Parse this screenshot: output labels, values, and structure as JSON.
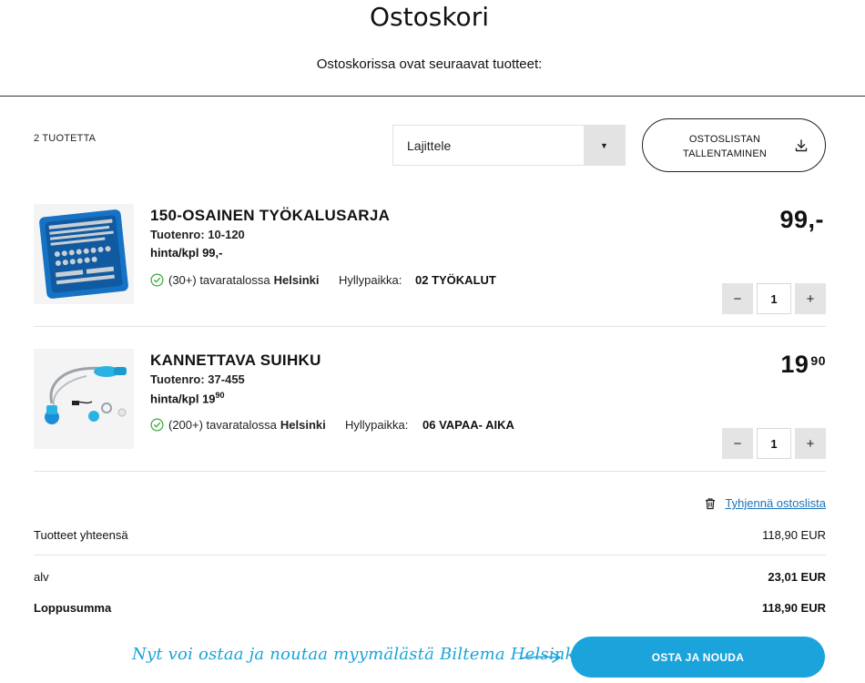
{
  "header": {
    "title": "Ostoskori",
    "subtitle": "Ostoskorissa ovat seuraavat tuotteet:"
  },
  "toolbar": {
    "product_count": "2 TUOTETTA",
    "sort_label": "Lajittele",
    "save_list_line1": "OSTOSLISTAN",
    "save_list_line2": "TALLENTAMINEN"
  },
  "products": [
    {
      "name": "150-OSAINEN TYÖKALUSARJA",
      "sku": "Tuotenro: 10-120",
      "unit_price_label": "hinta/kpl",
      "unit_price_main": "99,-",
      "unit_price_sup": "",
      "stock_text": "(30+) tavaratalossa",
      "stock_store": "Helsinki",
      "shelf_label": "Hyllypaikka:",
      "shelf_value": "02 TYÖKALUT",
      "price_main": "99,-",
      "price_sup": "",
      "quantity": "1",
      "image": "blue-tool-case"
    },
    {
      "name": "KANNETTAVA SUIHKU",
      "sku": "Tuotenro: 37-455",
      "unit_price_label": "hinta/kpl",
      "unit_price_main": "19",
      "unit_price_sup": "90",
      "stock_text": "(200+) tavaratalossa",
      "stock_store": "Helsinki",
      "shelf_label": "Hyllypaikka:",
      "shelf_value": "06 VAPAA- AIKA",
      "price_main": "19",
      "price_sup": "90",
      "quantity": "1",
      "image": "portable-shower"
    }
  ],
  "qty_controls": {
    "minus": "−",
    "plus": "+"
  },
  "clear_list": {
    "label": "Tyhjennä ostoslista",
    "icon": "trash-icon"
  },
  "summary": {
    "subtotal_label": "Tuotteet yhteensä",
    "subtotal_value": "118,90 EUR",
    "vat_label": "alv",
    "vat_value": "23,01 EUR",
    "total_label": "Loppusumma",
    "total_value": "118,90 EUR"
  },
  "footer": {
    "promo_text": "Nyt voi ostaa ja noutaa myymälästä Biltema Helsinki!",
    "buy_button": "OSTA JA NOUDA"
  },
  "colors": {
    "accent": "#1ba3dc",
    "link": "#1a73b8",
    "check": "#3aaa35",
    "qty_button": "#e4e4e4"
  }
}
